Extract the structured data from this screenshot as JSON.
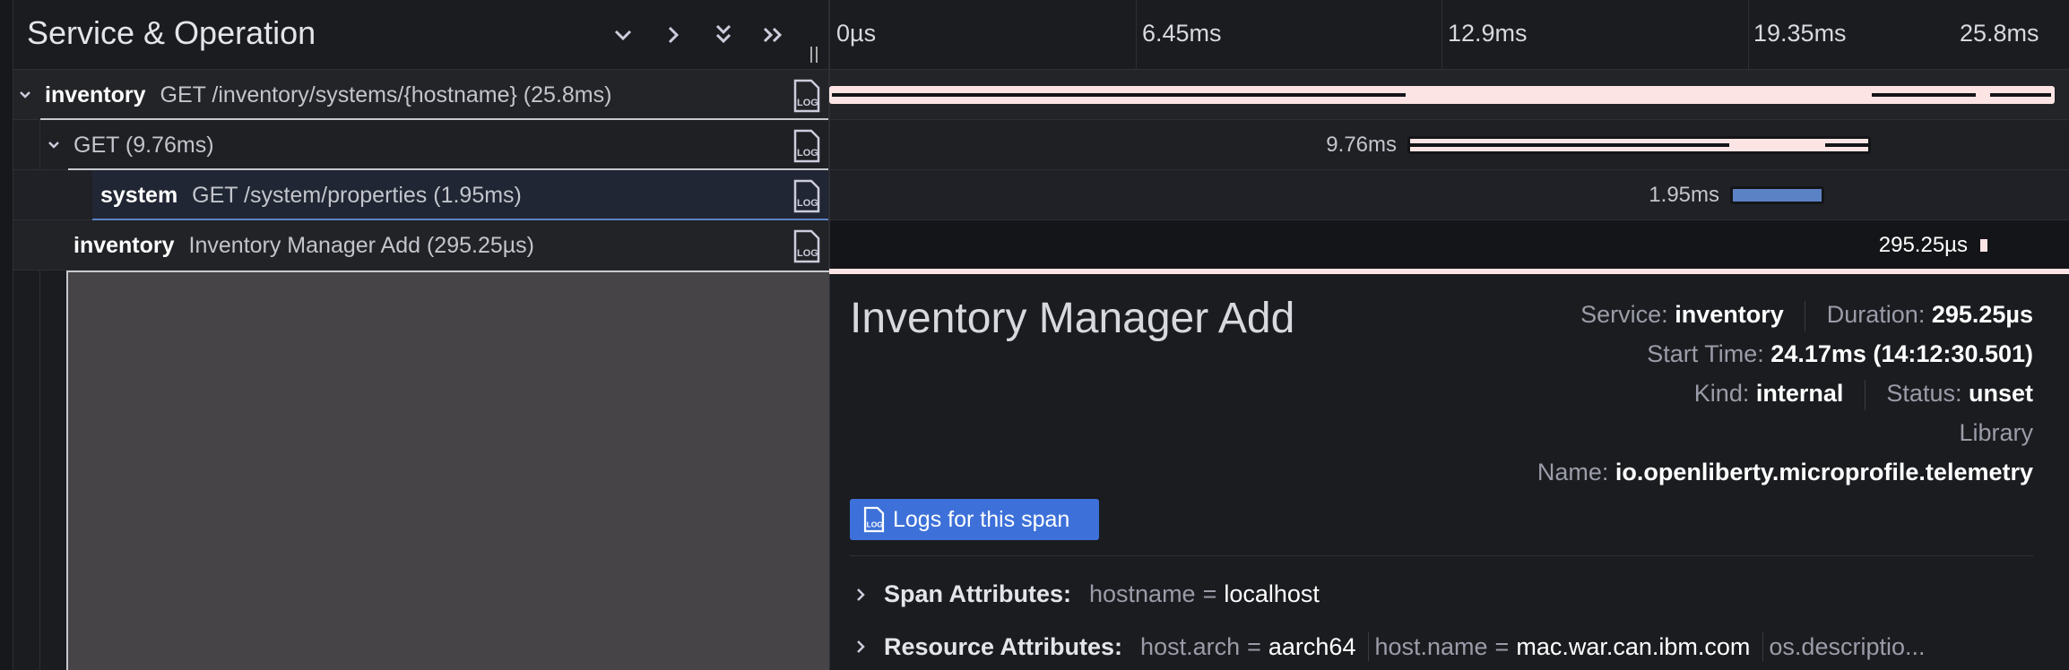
{
  "header": {
    "title": "Service & Operation",
    "ticks": [
      "0µs",
      "6.45ms",
      "12.9ms",
      "19.35ms",
      "25.8ms"
    ]
  },
  "rows": [
    {
      "service": "inventory",
      "operation": "GET /inventory/systems/{hostname} (25.8ms)",
      "duration": ""
    },
    {
      "service": "",
      "operation": "GET (9.76ms)",
      "duration": "9.76ms"
    },
    {
      "service": "system",
      "operation": "GET /system/properties (1.95ms)",
      "duration": "1.95ms"
    },
    {
      "service": "inventory",
      "operation": "Inventory Manager Add (295.25µs)",
      "duration": "295.25µs"
    }
  ],
  "detail": {
    "title": "Inventory Manager Add",
    "service_label": "Service:",
    "service_value": "inventory",
    "duration_label": "Duration:",
    "duration_value": "295.25µs",
    "start_label": "Start Time:",
    "start_value": "24.17ms (14:12:30.501)",
    "kind_label": "Kind:",
    "kind_value": "internal",
    "status_label": "Status:",
    "status_value": "unset",
    "library_label": "Library",
    "name_label": "Name:",
    "name_value": "io.openliberty.microprofile.telemetry",
    "logs_button": "Logs for this span",
    "span_attr_label": "Span Attributes:",
    "span_attr_key": "hostname",
    "span_attr_eq": "=",
    "span_attr_value": "localhost",
    "res_attr_label": "Resource Attributes:",
    "res_attr1_key": "host.arch",
    "res_attr1_value": "aarch64",
    "res_attr2_key": "host.name",
    "res_attr2_value": "mac.war.can.ibm.com",
    "res_attr3_trunc": "os.descriptio..."
  },
  "colors": {
    "bg": "#1b1c20",
    "bar_light": "#fbe4e3",
    "bar_blue": "#5b82c4",
    "button": "#3d71d9"
  }
}
